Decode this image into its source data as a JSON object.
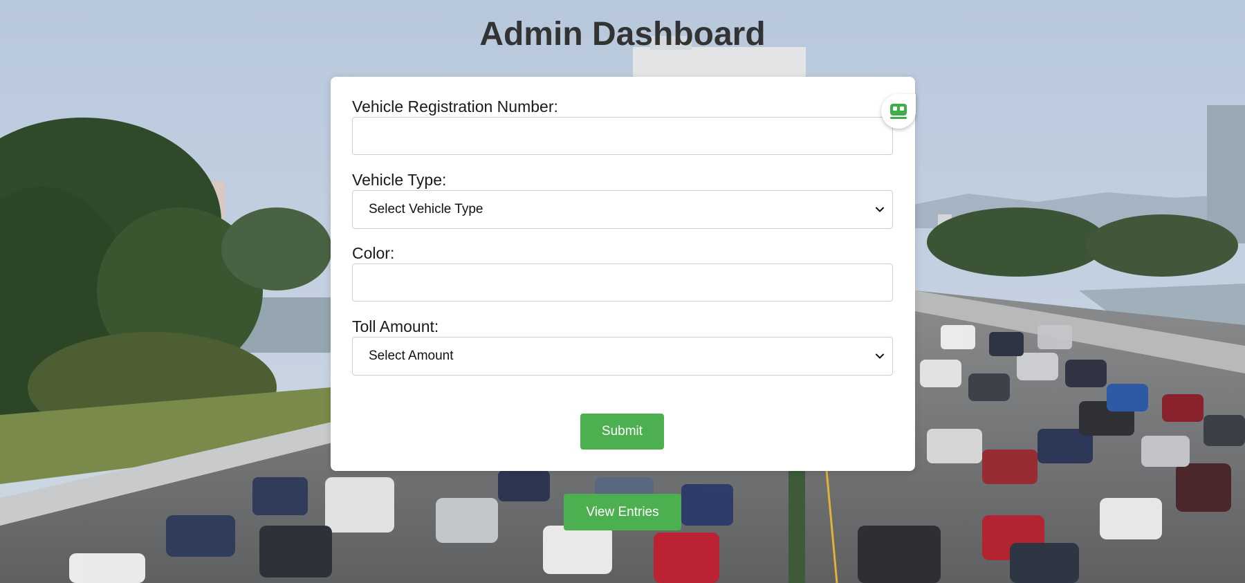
{
  "page": {
    "title": "Admin Dashboard"
  },
  "form": {
    "registration": {
      "label": "Vehicle Registration Number:",
      "value": ""
    },
    "vehicle_type": {
      "label": "Vehicle Type:",
      "selected": "Select Vehicle Type"
    },
    "color": {
      "label": "Color:",
      "value": ""
    },
    "toll_amount": {
      "label": "Toll Amount:",
      "selected": "Select Amount"
    },
    "submit_label": "Submit"
  },
  "actions": {
    "view_entries_label": "View Entries"
  },
  "extension": {
    "icon": "robot-face-icon"
  },
  "colors": {
    "accent": "#4caf50",
    "title": "#333333",
    "extension": "#3fae49"
  }
}
